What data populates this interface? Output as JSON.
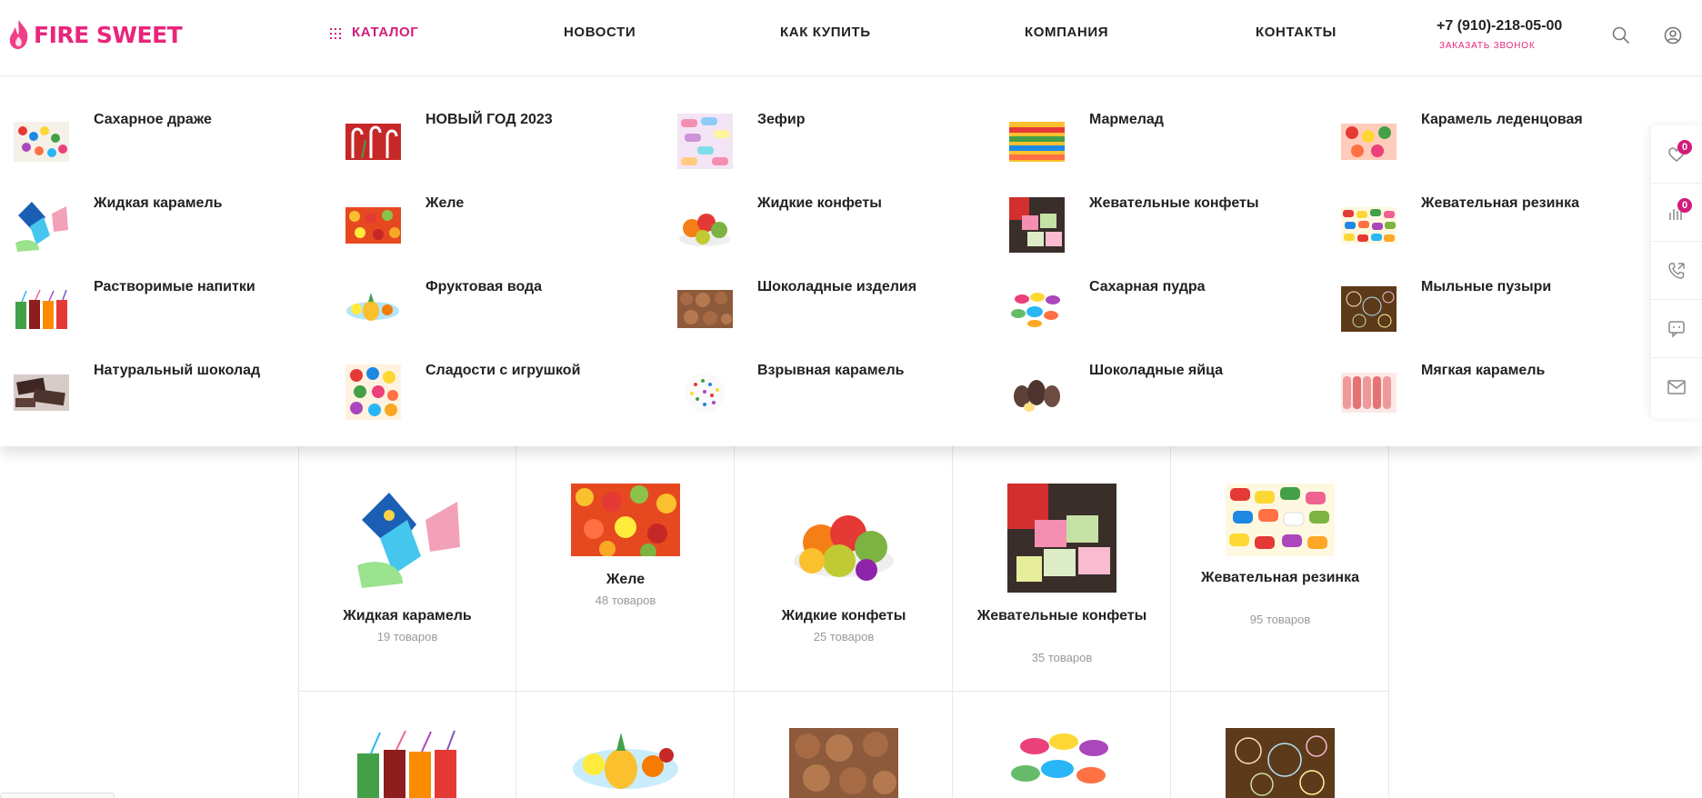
{
  "brand": {
    "logo_text": "FIRE SWEET",
    "accent": "#e8267b"
  },
  "nav": {
    "items": [
      {
        "label": "КАТАЛОГ",
        "active": true
      },
      {
        "label": "НОВОСТИ"
      },
      {
        "label": "КАК КУПИТЬ"
      },
      {
        "label": "КОМПАНИЯ"
      },
      {
        "label": "КОНТАКТЫ"
      }
    ],
    "phone": "+7 (910)-218-05-00",
    "callback": "ЗАКАЗАТЬ ЗВОНОК",
    "icons": [
      "search-icon",
      "user-icon"
    ]
  },
  "catalog_menu": [
    [
      "Сахарное драже",
      "НОВЫЙ ГОД 2023",
      "Зефир",
      "Мармелад",
      "Карамель леденцовая"
    ],
    [
      "Жидкая карамель",
      "Желе",
      "Жидкие конфеты",
      "Жевательные конфеты",
      "Жевательная резинка"
    ],
    [
      "Растворимые напитки",
      "Фруктовая вода",
      "Шоколадные изделия",
      "Сахарная пудра",
      "Мыльные пузыри"
    ],
    [
      "Натуральный шоколад",
      "Сладости с игрушкой",
      "Взрывная карамель",
      "Шоколадные яйца",
      "Мягкая карамель"
    ]
  ],
  "side_panel": {
    "favorites_count": "0",
    "compare_count": "0",
    "icons": [
      "heart-icon",
      "compare-icon",
      "callback-phone-icon",
      "chat-icon",
      "mail-icon"
    ]
  },
  "category_cards": [
    {
      "title": "Жидкая карамель",
      "count": "19 товаров"
    },
    {
      "title": "Желе",
      "count": "48 товаров"
    },
    {
      "title": "Жидкие конфеты",
      "count": "25 товаров"
    },
    {
      "title": "Жевательные конфеты",
      "count": "35 товаров"
    },
    {
      "title": "Жевательная резинка",
      "count": "95 товаров"
    }
  ]
}
